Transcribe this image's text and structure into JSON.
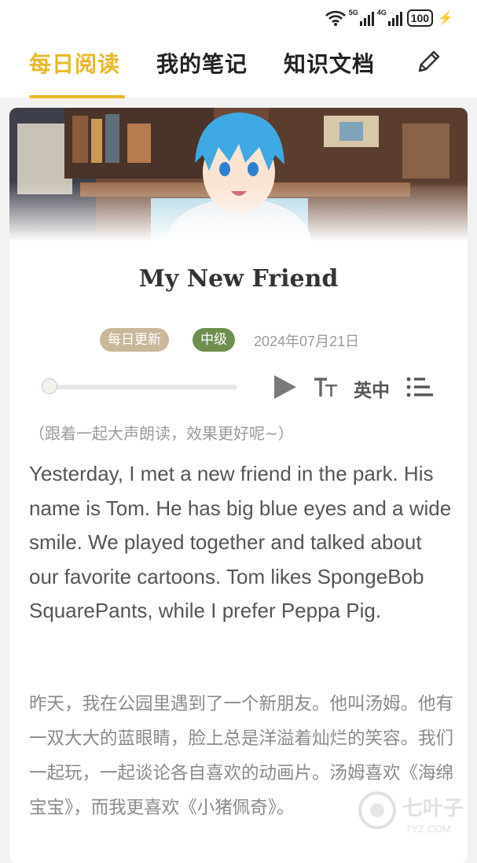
{
  "status": {
    "signal1": "5G",
    "signal2": "4G",
    "battery": "100"
  },
  "tabs": [
    {
      "label": "每日阅读",
      "active": true
    },
    {
      "label": "我的笔记",
      "active": false
    },
    {
      "label": "知识文档",
      "active": false
    }
  ],
  "header": {
    "edit_icon": "pencil-icon",
    "accent": "#eab82a"
  },
  "article": {
    "title": "My New Friend",
    "tag_daily": "每日更新",
    "tag_level": "中级",
    "date": "2024年07月21日",
    "hint": "（跟着一起大声朗读，效果更好呢~）",
    "english": "Yesterday, I met a new friend in the park. His name is Tom. He has big blue eyes and a wide smile. We played together and talked about our favorite cartoons. Tom likes SpongeBob SquarePants, while I prefer Peppa Pig.",
    "chinese": "昨天，我在公园里遇到了一个新朋友。他叫汤姆。他有一双大大的蓝眼睛，脸上总是洋溢着灿烂的笑容。我们一起玩，一起谈论各自喜欢的动画片。汤姆喜欢《海绵宝宝》，而我更喜欢《小猪佩奇》。"
  },
  "player": {
    "progress": 0,
    "play_icon": "play-icon",
    "font_icon": "font-size-icon",
    "language_label": "英中",
    "list_icon": "list-icon"
  },
  "watermark": {
    "text": "七叶子",
    "subtext": "7YZ.COM"
  }
}
